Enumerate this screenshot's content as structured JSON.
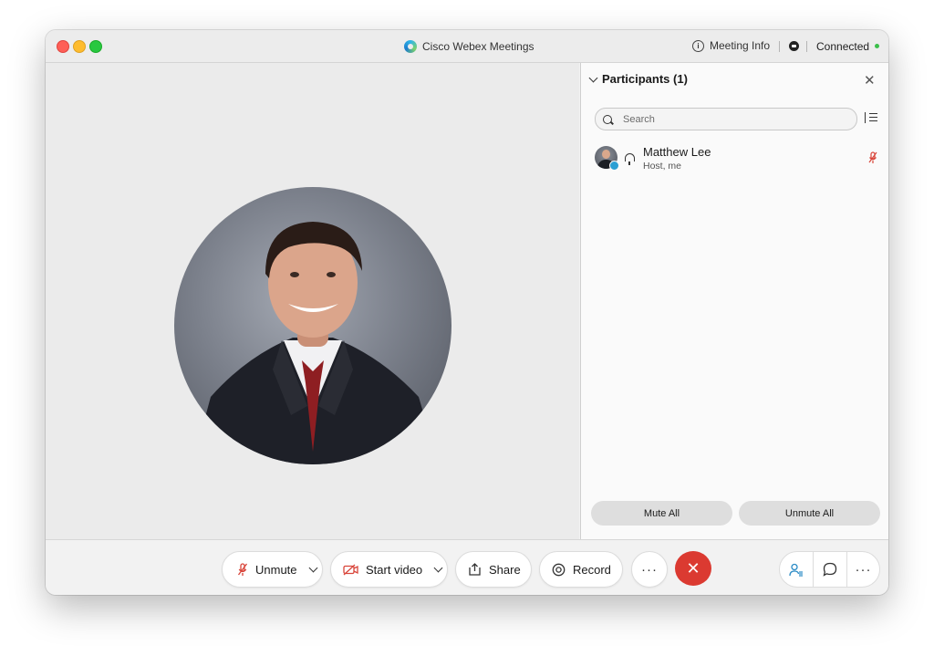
{
  "titlebar": {
    "app_title": "Cisco Webex Meetings",
    "meeting_info": "Meeting Info",
    "connection_status": "Connected",
    "status_color": "#3bbf4a"
  },
  "participants_panel": {
    "title": "Participants (1)",
    "search_placeholder": "Search",
    "participants": [
      {
        "name": "Matthew Lee",
        "role": "Host, me",
        "mic": "muted"
      }
    ],
    "mute_all_label": "Mute All",
    "unmute_all_label": "Unmute All"
  },
  "controls": {
    "unmute_label": "Unmute",
    "start_video_label": "Start video",
    "share_label": "Share",
    "record_label": "Record",
    "end_color": "#db3a31",
    "muted_icon_color": "#d9453a"
  }
}
